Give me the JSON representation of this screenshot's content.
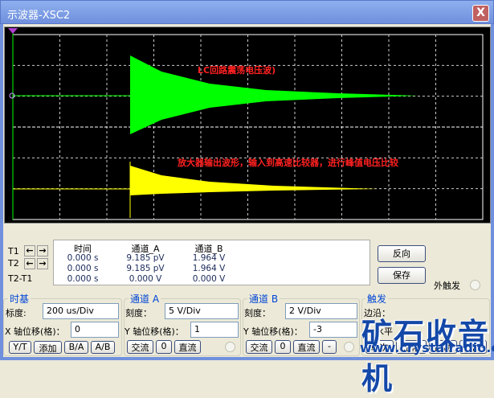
{
  "window": {
    "title": "示波器-XSC2",
    "close": "X"
  },
  "annotations": {
    "top": "LC回路震荡电压波)",
    "bottom": "放大器输出波形，输入到高速比较器，进行峰值电压比较"
  },
  "colors": {
    "channel_a": "#00ff00",
    "channel_b": "#ffff00",
    "annotation": "#ff2020",
    "grid": "#ffffff"
  },
  "cursors": {
    "t1": "T1",
    "t2": "T2",
    "t2t1": "T2-T1"
  },
  "readout": {
    "headers": [
      "时间",
      "通道_A",
      "通道_B"
    ],
    "rows": [
      [
        "0.000 s",
        "9.185 pV",
        "1.964 V"
      ],
      [
        "0.000 s",
        "9.185 pV",
        "1.964 V"
      ],
      [
        "0.000 s",
        "0.000 V",
        "0.000 V"
      ]
    ]
  },
  "buttons": {
    "reverse": "反向",
    "save": "保存",
    "ext_trigger": "外触发"
  },
  "timebase": {
    "title": "时基",
    "scale_label": "标度:",
    "scale": "200 us/Div",
    "xpos_label": "X 轴位移(格)：",
    "xpos": "0",
    "modes": [
      "Y/T",
      "添加",
      "B/A",
      "A/B"
    ]
  },
  "channel_a": {
    "title": "通道 A",
    "scale_label": "刻度：",
    "scale": "5  V/Div",
    "ypos_label": "Y 轴位移(格)：",
    "ypos": "1",
    "coupling": [
      "交流",
      "0",
      "直流"
    ]
  },
  "channel_b": {
    "title": "通道 B",
    "scale_label": "刻度：",
    "scale": "2  V/Div",
    "ypos_label": "Y 轴位移(格)：",
    "ypos": "-3",
    "coupling": [
      "交流",
      "0",
      "直流",
      "-"
    ]
  },
  "trigger": {
    "title": "触发",
    "edge_label": "边沿：",
    "level_label": "水平",
    "modes": [
      "单次",
      "正常",
      "自动",
      "无"
    ]
  },
  "watermark": {
    "text": "矿石收音机",
    "url": "www.crystalradio.cn"
  }
}
